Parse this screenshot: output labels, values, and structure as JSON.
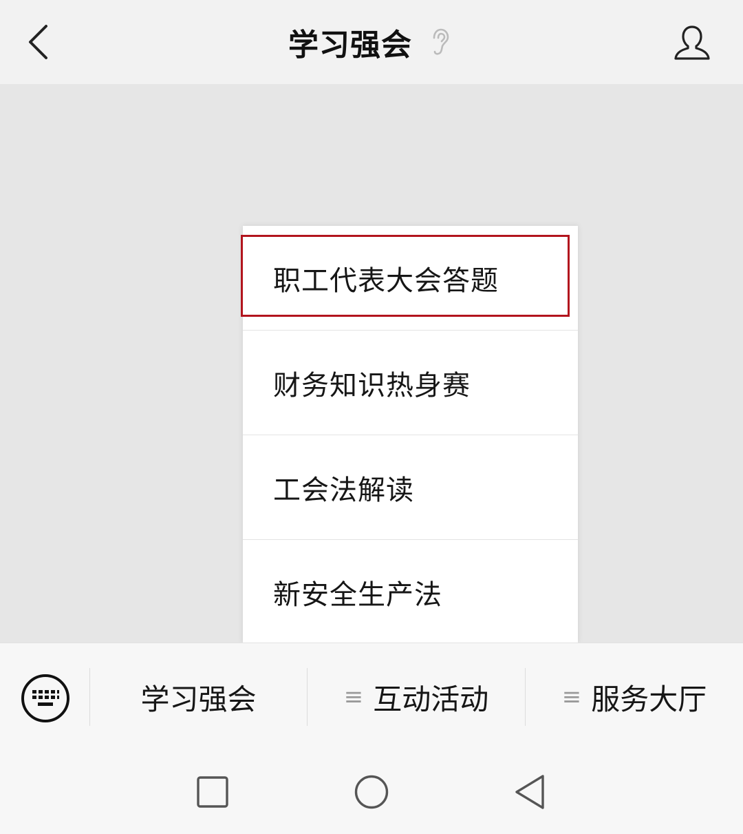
{
  "header": {
    "title": "学习强会",
    "back_icon": "chevron-left-icon",
    "ear_icon": "ear-icon",
    "profile_icon": "user-icon"
  },
  "popup_menu": {
    "items": [
      {
        "label": "职工代表大会答题",
        "highlighted": true
      },
      {
        "label": "财务知识热身赛",
        "highlighted": false
      },
      {
        "label": "工会法解读",
        "highlighted": false
      },
      {
        "label": "新安全生产法",
        "highlighted": false
      }
    ],
    "highlight_color": "#b2141d"
  },
  "menubar": {
    "keyboard_icon": "keyboard-icon",
    "items": [
      {
        "label": "学习强会",
        "has_submenu_icon": false
      },
      {
        "label": "互动活动",
        "has_submenu_icon": true
      },
      {
        "label": "服务大厅",
        "has_submenu_icon": true
      }
    ],
    "submenu_glyph": "≡"
  },
  "system_nav": {
    "buttons": [
      "recents-square-icon",
      "home-circle-icon",
      "back-triangle-icon"
    ]
  }
}
